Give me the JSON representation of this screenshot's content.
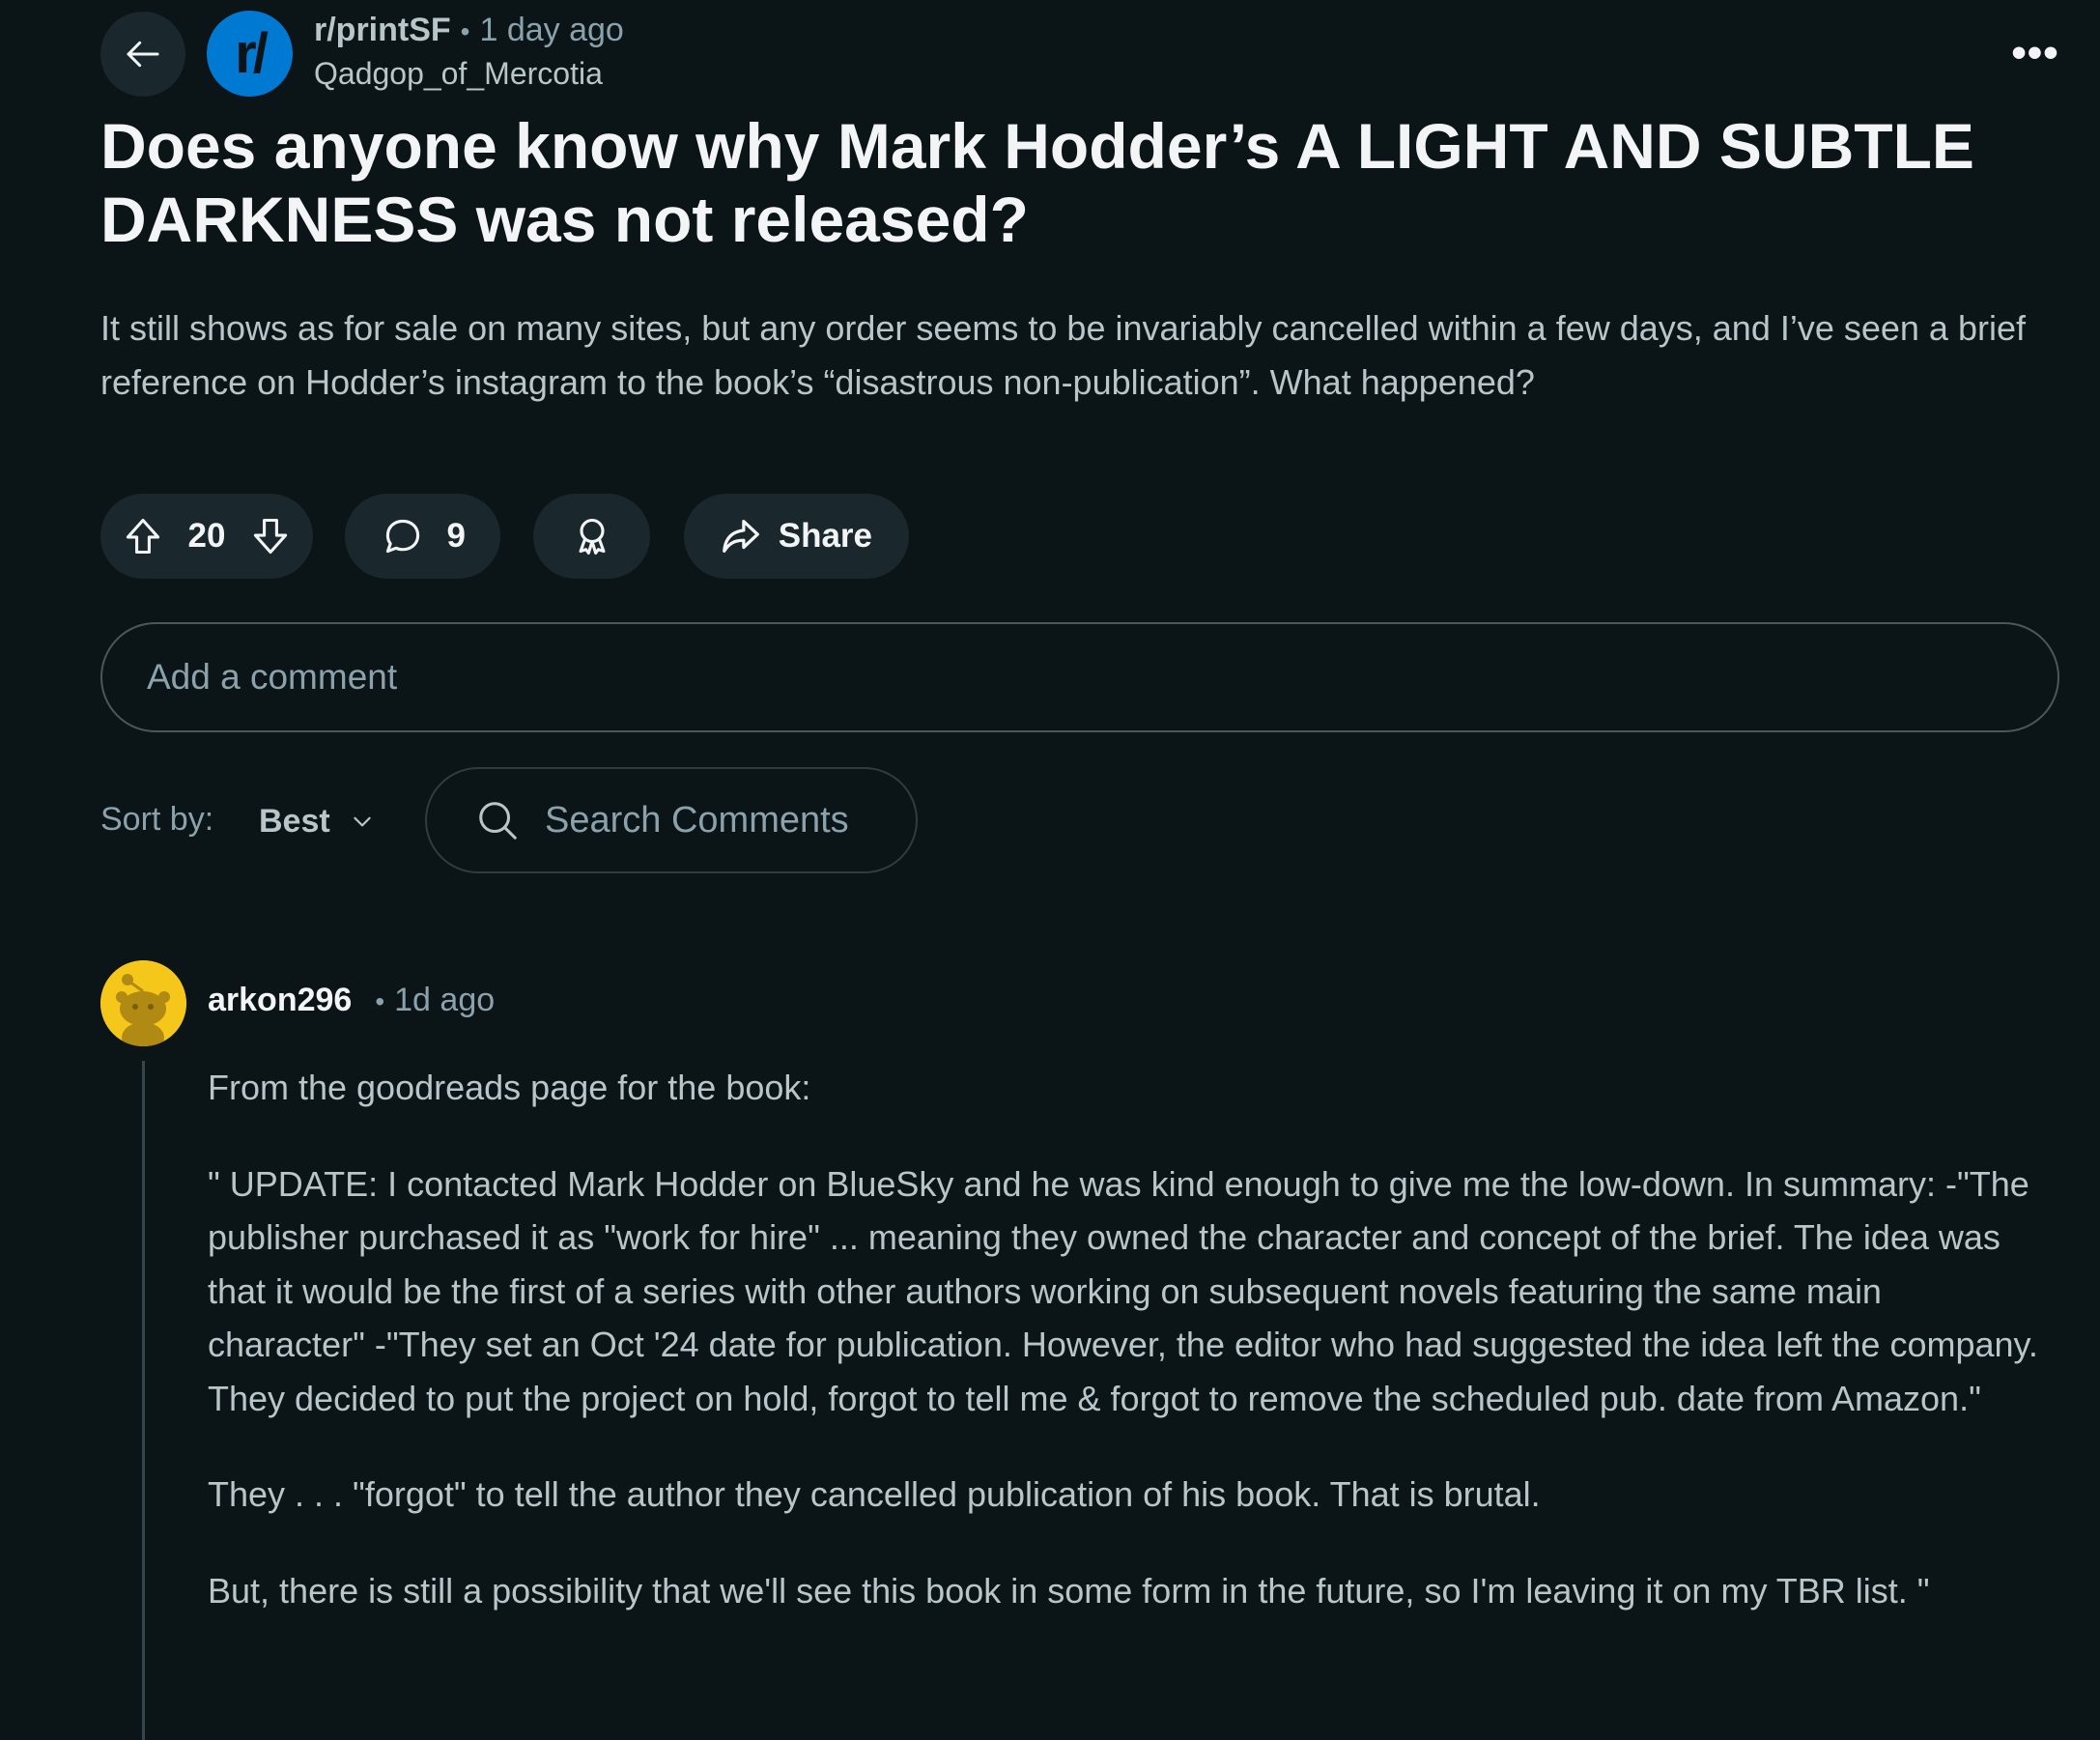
{
  "header": {
    "subreddit": "r/printSF",
    "subreddit_icon_text": "r/",
    "separator": "•",
    "time": "1 day ago",
    "author": "Qadgop_of_Mercotia",
    "more_label": "•••"
  },
  "post": {
    "title": "Does anyone know why Mark Hodder’s A LIGHT AND SUBTLE DARKNESS was not released?",
    "body": "It still shows as for sale on many sites, but any order seems to be invariably cancelled within a few days, and I’ve seen a brief reference on Hodder’s instagram to the book’s “disastrous non-publication”. What happened?"
  },
  "actions": {
    "vote_count": "20",
    "comment_count": "9",
    "share_label": "Share"
  },
  "comment_box": {
    "placeholder": "Add a comment"
  },
  "sort": {
    "label": "Sort by:",
    "value": "Best",
    "search_placeholder": "Search Comments"
  },
  "comment": {
    "author": "arkon296",
    "separator": "•",
    "time": "1d ago",
    "paragraphs": [
      "From the goodreads page for the book:",
      "\" UPDATE: I contacted Mark Hodder on BlueSky and he was kind enough to give me the low-down. In summary: -\"The publisher purchased it as \"work for hire\" ... meaning they owned the character and concept of the brief. The idea was that it would be the first of a series with other authors working on subsequent novels featuring the same main character\" -\"They set an Oct '24 date for publication. However, the editor who had suggested the idea left the company. They decided to put the project on hold, forgot to tell me & forgot to remove the scheduled pub. date from Amazon.\"",
      "They . . . \"forgot\" to tell the author they cancelled publication of his book. That is brutal.",
      "But, there is still a possibility that we'll see this book in some form in the future, so I'm leaving it on my TBR list. \""
    ]
  },
  "colors": {
    "background": "#0b1416",
    "pill": "#1a282d",
    "subreddit_icon": "#0079d3",
    "avatar": "#f5c71a",
    "primary_text": "#f2f4f5",
    "secondary_text": "#b8c5c9",
    "meta_text": "#8ba2ad"
  },
  "icons": {
    "back": "arrow-left-icon",
    "upvote": "upvote-arrow-icon",
    "downvote": "downvote-arrow-icon",
    "comment": "speech-bubble-icon",
    "award": "award-ribbon-icon",
    "share": "share-arrow-icon",
    "sort": "chevron-down-icon",
    "search": "search-icon",
    "more": "more-dots-icon"
  }
}
